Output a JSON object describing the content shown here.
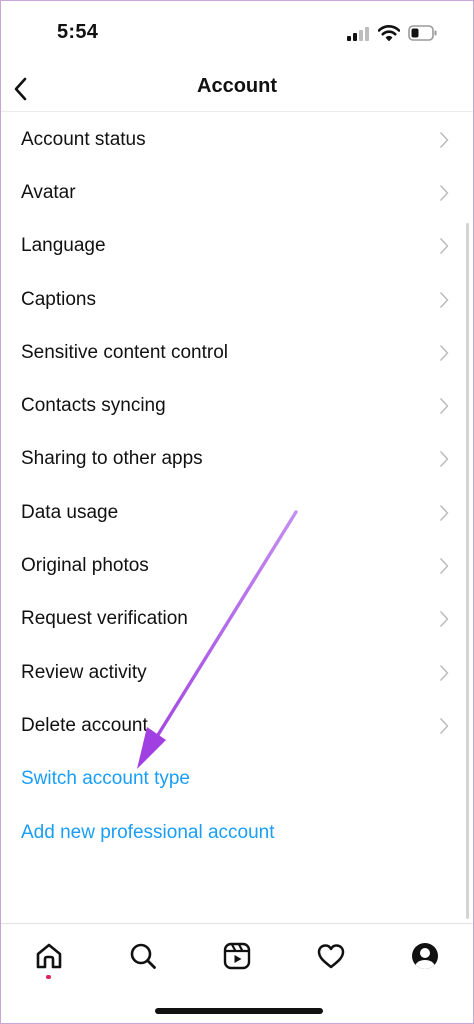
{
  "status_bar": {
    "time": "5:54"
  },
  "header": {
    "title": "Account",
    "back_icon": "chevron-left-icon"
  },
  "menu": {
    "items": [
      {
        "label": "Account status"
      },
      {
        "label": "Avatar"
      },
      {
        "label": "Language"
      },
      {
        "label": "Captions"
      },
      {
        "label": "Sensitive content control"
      },
      {
        "label": "Contacts syncing"
      },
      {
        "label": "Sharing to other apps"
      },
      {
        "label": "Data usage"
      },
      {
        "label": "Original photos"
      },
      {
        "label": "Request verification"
      },
      {
        "label": "Review activity"
      },
      {
        "label": "Delete account"
      }
    ],
    "links": [
      {
        "label": "Switch account type"
      },
      {
        "label": "Add new professional account"
      }
    ]
  },
  "bottom_nav": {
    "items": [
      {
        "icon": "home-icon"
      },
      {
        "icon": "search-icon"
      },
      {
        "icon": "reels-icon"
      },
      {
        "icon": "heart-icon"
      },
      {
        "icon": "profile-icon"
      }
    ]
  },
  "colors": {
    "link": "#1a9ef5",
    "annotation_arrow": "#a64ee0",
    "notification_dot": "#e0245e"
  }
}
